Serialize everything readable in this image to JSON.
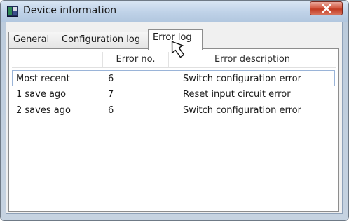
{
  "window": {
    "title": "Device information",
    "close_glyph": "x"
  },
  "tabs": [
    {
      "label": "General",
      "active": false
    },
    {
      "label": "Configuration log",
      "active": false
    },
    {
      "label": "Error log",
      "active": true
    }
  ],
  "error_log": {
    "columns": [
      "",
      "Error no.",
      "Error description"
    ],
    "rows": [
      {
        "when": "Most recent",
        "error_no": "6",
        "description": "Switch configuration error",
        "selected": true
      },
      {
        "when": "1 save ago",
        "error_no": "7",
        "description": "Reset input circuit error",
        "selected": false
      },
      {
        "when": "2 saves ago",
        "error_no": "6",
        "description": "Switch configuration error",
        "selected": false
      }
    ]
  },
  "colors": {
    "selection_border": "#9ab4d8",
    "close_button": "#c23b22"
  },
  "icons": {
    "app": "device-app-icon",
    "close": "close-icon",
    "pointer": "mouse-pointer-icon"
  }
}
